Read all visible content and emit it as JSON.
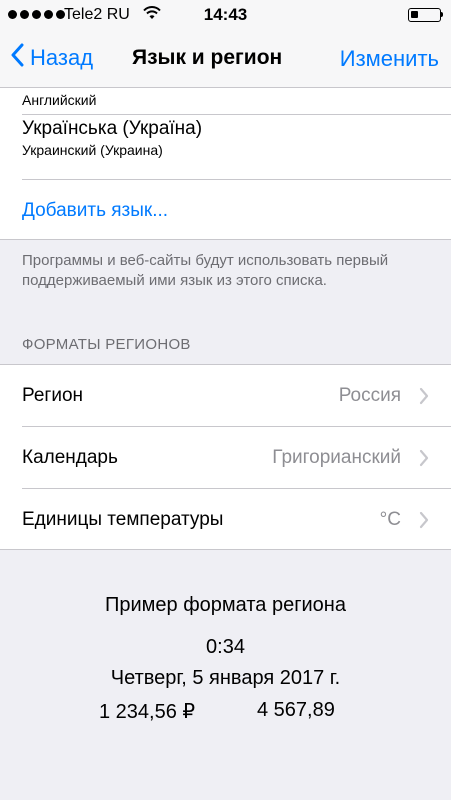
{
  "status": {
    "carrier": "Tele2 RU",
    "time": "14:43"
  },
  "nav": {
    "back": "Назад",
    "title": "Язык и регион",
    "edit": "Изменить"
  },
  "languages": {
    "partial_sub": "Английский",
    "items": [
      {
        "main": "Українська (Україна)",
        "sub": "Украинский (Украина)"
      }
    ],
    "add": "Добавить язык..."
  },
  "note": "Программы и веб-сайты будут использовать первый поддерживаемый ими язык из этого списка.",
  "region_formats": {
    "header": "ФОРМАТЫ РЕГИОНОВ",
    "rows": [
      {
        "label": "Регион",
        "value": "Россия"
      },
      {
        "label": "Календарь",
        "value": "Григорианский"
      },
      {
        "label": "Единицы температуры",
        "value": "°C"
      }
    ]
  },
  "example": {
    "title": "Пример формата региона",
    "time": "0:34",
    "date": "Четверг, 5 января 2017 г.",
    "number1": "1 234,56 ₽",
    "number2": "4 567,89"
  }
}
